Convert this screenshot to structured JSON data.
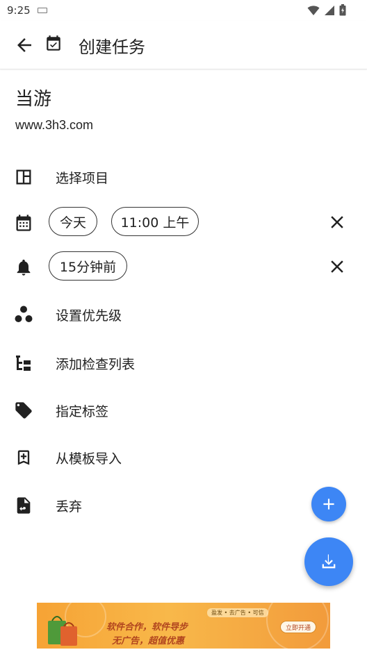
{
  "status_bar": {
    "time": "9:25",
    "icons": [
      "keyboard-icon",
      "wifi-icon",
      "signal-icon",
      "battery-icon"
    ]
  },
  "app_bar": {
    "title": "创建任务",
    "icons": [
      "arrow-back-icon",
      "calendar-check-icon"
    ]
  },
  "task": {
    "title": "当游",
    "description": "www.3h3.com"
  },
  "rows": {
    "project": {
      "label": "选择项目",
      "icon": "dashboard-icon"
    },
    "date": {
      "icon": "calendar-icon",
      "date_chip": "今天",
      "time_chip": "11:00 上午"
    },
    "reminder": {
      "icon": "bell-icon",
      "chip": "15分钟前"
    },
    "priority": {
      "label": "设置优先级",
      "icon": "priority-dots-icon"
    },
    "checklist": {
      "label": "添加检查列表",
      "icon": "checklist-icon"
    },
    "tags": {
      "label": "指定标签",
      "icon": "tag-icon"
    },
    "template": {
      "label": "从模板导入",
      "icon": "bookmark-add-icon"
    },
    "discard": {
      "label": "丢弃",
      "icon": "file-undo-icon"
    }
  },
  "fabs": {
    "add": "add-icon",
    "download": "download-icon",
    "color": "#3d86f5"
  },
  "ad": {
    "top_text": "盈发 • 去广告 • 可信",
    "line1": "软件合作，软件导步",
    "line2": "无广告，超值优惠",
    "button": "立即开通"
  }
}
